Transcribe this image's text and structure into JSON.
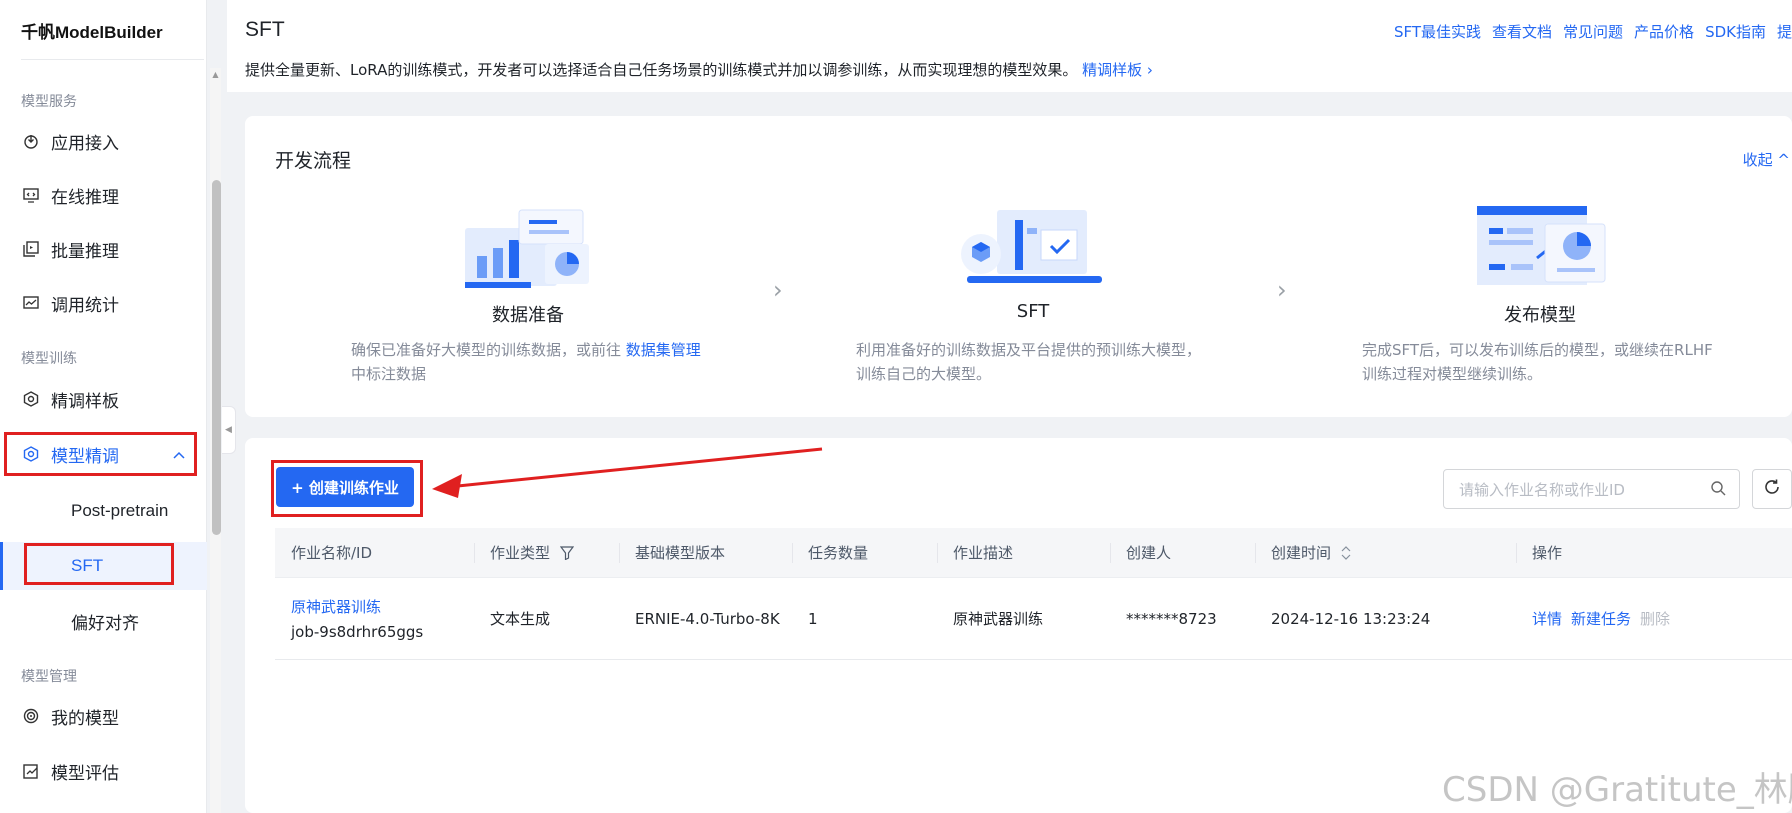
{
  "sidebar": {
    "brand": "千帆ModelBuilder",
    "groups": [
      {
        "title": "模型服务",
        "items": [
          "应用接入",
          "在线推理",
          "批量推理",
          "调用统计"
        ]
      },
      {
        "title": "模型训练",
        "items": [
          "精调样板",
          "模型精调"
        ],
        "subitems": [
          "Post-pretrain",
          "SFT",
          "偏好对齐"
        ]
      },
      {
        "title": "模型管理",
        "items": [
          "我的模型",
          "模型评估"
        ]
      }
    ],
    "selected": "SFT",
    "expanded": "模型精调"
  },
  "header": {
    "title": "SFT",
    "desc": "提供全量更新、LoRA的训练模式，开发者可以选择适合自己任务场景的训练模式并加以调参训练，从而实现理想的模型效果。",
    "desc_link": "精调样板 ›",
    "links": [
      "SFT最佳实践",
      "查看文档",
      "常见问题",
      "产品价格",
      "SDK指南",
      "提"
    ]
  },
  "process": {
    "title": "开发流程",
    "collapse": "收起 ^",
    "steps": [
      {
        "name": "数据准备",
        "desc_pre": "确保已准备好大模型的训练数据，或前往 ",
        "desc_link": "数据集管理",
        "desc_post": " 中标注数据"
      },
      {
        "name": "SFT",
        "desc": "利用准备好的训练数据及平台提供的预训练大模型，训练自己的大模型。"
      },
      {
        "name": "发布模型",
        "desc": "完成SFT后，可以发布训练后的模型，或继续在RLHF训练过程对模型继续训练。"
      }
    ]
  },
  "jobs": {
    "create_button": "+ 创建训练作业",
    "search_placeholder": "请输入作业名称或作业ID",
    "columns": [
      "作业名称/ID",
      "作业类型",
      "基础模型版本",
      "任务数量",
      "作业描述",
      "创建人",
      "创建时间",
      "操作"
    ],
    "rows": [
      {
        "name": "原神武器训练",
        "id": "job-9s8drhr65ggs",
        "type": "文本生成",
        "base_model": "ERNIE-4.0-Turbo-8K",
        "task_count": "1",
        "desc": "原神武器训练",
        "creator": "*******8723",
        "created_at": "2024-12-16 13:23:24",
        "ops": [
          "详情",
          "新建任务",
          "删除"
        ]
      }
    ]
  },
  "watermark": "CSDN @Gratitute_林腾",
  "colors": {
    "accent": "#2468f2",
    "annotation": "#e02020"
  }
}
